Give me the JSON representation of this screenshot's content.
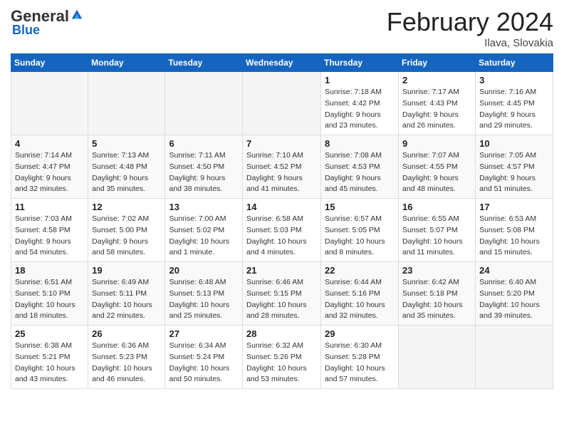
{
  "logo": {
    "general": "General",
    "blue": "Blue"
  },
  "title": "February 2024",
  "location": "Ilava, Slovakia",
  "days_of_week": [
    "Sunday",
    "Monday",
    "Tuesday",
    "Wednesday",
    "Thursday",
    "Friday",
    "Saturday"
  ],
  "weeks": [
    [
      {
        "num": "",
        "detail": ""
      },
      {
        "num": "",
        "detail": ""
      },
      {
        "num": "",
        "detail": ""
      },
      {
        "num": "",
        "detail": ""
      },
      {
        "num": "1",
        "detail": "Sunrise: 7:18 AM\nSunset: 4:42 PM\nDaylight: 9 hours\nand 23 minutes."
      },
      {
        "num": "2",
        "detail": "Sunrise: 7:17 AM\nSunset: 4:43 PM\nDaylight: 9 hours\nand 26 minutes."
      },
      {
        "num": "3",
        "detail": "Sunrise: 7:16 AM\nSunset: 4:45 PM\nDaylight: 9 hours\nand 29 minutes."
      }
    ],
    [
      {
        "num": "4",
        "detail": "Sunrise: 7:14 AM\nSunset: 4:47 PM\nDaylight: 9 hours\nand 32 minutes."
      },
      {
        "num": "5",
        "detail": "Sunrise: 7:13 AM\nSunset: 4:48 PM\nDaylight: 9 hours\nand 35 minutes."
      },
      {
        "num": "6",
        "detail": "Sunrise: 7:11 AM\nSunset: 4:50 PM\nDaylight: 9 hours\nand 38 minutes."
      },
      {
        "num": "7",
        "detail": "Sunrise: 7:10 AM\nSunset: 4:52 PM\nDaylight: 9 hours\nand 41 minutes."
      },
      {
        "num": "8",
        "detail": "Sunrise: 7:08 AM\nSunset: 4:53 PM\nDaylight: 9 hours\nand 45 minutes."
      },
      {
        "num": "9",
        "detail": "Sunrise: 7:07 AM\nSunset: 4:55 PM\nDaylight: 9 hours\nand 48 minutes."
      },
      {
        "num": "10",
        "detail": "Sunrise: 7:05 AM\nSunset: 4:57 PM\nDaylight: 9 hours\nand 51 minutes."
      }
    ],
    [
      {
        "num": "11",
        "detail": "Sunrise: 7:03 AM\nSunset: 4:58 PM\nDaylight: 9 hours\nand 54 minutes."
      },
      {
        "num": "12",
        "detail": "Sunrise: 7:02 AM\nSunset: 5:00 PM\nDaylight: 9 hours\nand 58 minutes."
      },
      {
        "num": "13",
        "detail": "Sunrise: 7:00 AM\nSunset: 5:02 PM\nDaylight: 10 hours\nand 1 minute."
      },
      {
        "num": "14",
        "detail": "Sunrise: 6:58 AM\nSunset: 5:03 PM\nDaylight: 10 hours\nand 4 minutes."
      },
      {
        "num": "15",
        "detail": "Sunrise: 6:57 AM\nSunset: 5:05 PM\nDaylight: 10 hours\nand 8 minutes."
      },
      {
        "num": "16",
        "detail": "Sunrise: 6:55 AM\nSunset: 5:07 PM\nDaylight: 10 hours\nand 11 minutes."
      },
      {
        "num": "17",
        "detail": "Sunrise: 6:53 AM\nSunset: 5:08 PM\nDaylight: 10 hours\nand 15 minutes."
      }
    ],
    [
      {
        "num": "18",
        "detail": "Sunrise: 6:51 AM\nSunset: 5:10 PM\nDaylight: 10 hours\nand 18 minutes."
      },
      {
        "num": "19",
        "detail": "Sunrise: 6:49 AM\nSunset: 5:11 PM\nDaylight: 10 hours\nand 22 minutes."
      },
      {
        "num": "20",
        "detail": "Sunrise: 6:48 AM\nSunset: 5:13 PM\nDaylight: 10 hours\nand 25 minutes."
      },
      {
        "num": "21",
        "detail": "Sunrise: 6:46 AM\nSunset: 5:15 PM\nDaylight: 10 hours\nand 28 minutes."
      },
      {
        "num": "22",
        "detail": "Sunrise: 6:44 AM\nSunset: 5:16 PM\nDaylight: 10 hours\nand 32 minutes."
      },
      {
        "num": "23",
        "detail": "Sunrise: 6:42 AM\nSunset: 5:18 PM\nDaylight: 10 hours\nand 35 minutes."
      },
      {
        "num": "24",
        "detail": "Sunrise: 6:40 AM\nSunset: 5:20 PM\nDaylight: 10 hours\nand 39 minutes."
      }
    ],
    [
      {
        "num": "25",
        "detail": "Sunrise: 6:38 AM\nSunset: 5:21 PM\nDaylight: 10 hours\nand 43 minutes."
      },
      {
        "num": "26",
        "detail": "Sunrise: 6:36 AM\nSunset: 5:23 PM\nDaylight: 10 hours\nand 46 minutes."
      },
      {
        "num": "27",
        "detail": "Sunrise: 6:34 AM\nSunset: 5:24 PM\nDaylight: 10 hours\nand 50 minutes."
      },
      {
        "num": "28",
        "detail": "Sunrise: 6:32 AM\nSunset: 5:26 PM\nDaylight: 10 hours\nand 53 minutes."
      },
      {
        "num": "29",
        "detail": "Sunrise: 6:30 AM\nSunset: 5:28 PM\nDaylight: 10 hours\nand 57 minutes."
      },
      {
        "num": "",
        "detail": ""
      },
      {
        "num": "",
        "detail": ""
      }
    ]
  ]
}
